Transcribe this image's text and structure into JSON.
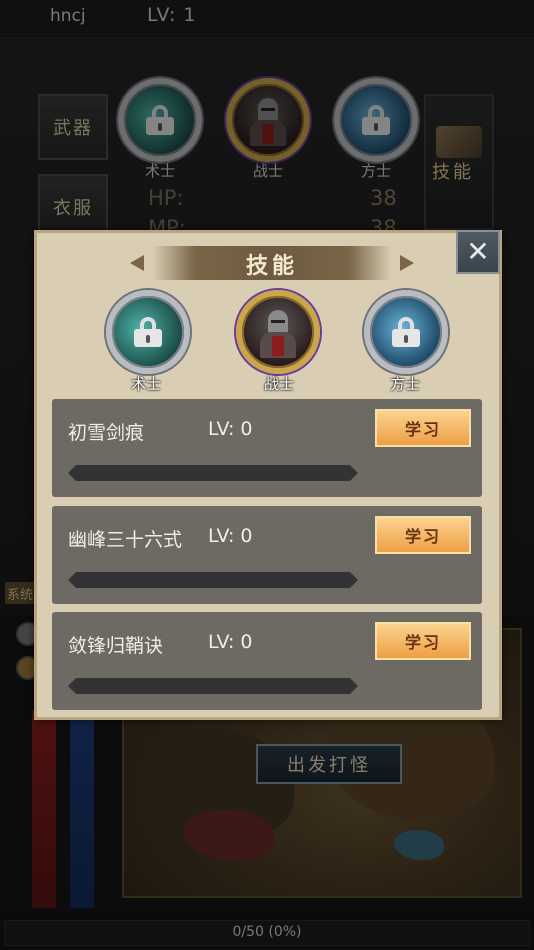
{
  "header": {
    "player_name": "hncj",
    "level": "LV: 1"
  },
  "side_tabs": [
    "武器",
    "衣服"
  ],
  "skill_tab_label": "技能",
  "top_characters": [
    {
      "label": "术士",
      "locked": true
    },
    {
      "label": "战士",
      "locked": false
    },
    {
      "label": "方士",
      "locked": true
    }
  ],
  "stats": [
    {
      "label": "HP:",
      "value": "38"
    },
    {
      "label": "MP:",
      "value": "38"
    }
  ],
  "system_tag": "系统",
  "map": {
    "go_button": "出发打怪"
  },
  "footer": {
    "xp_text": "0/50  (0%)"
  },
  "skill_dialog": {
    "title": "技能",
    "characters": [
      {
        "label": "术士",
        "locked": true
      },
      {
        "label": "战士",
        "locked": false
      },
      {
        "label": "方士",
        "locked": true
      }
    ],
    "skills": [
      {
        "name": "初雪剑痕",
        "level": "LV: 0",
        "button": "学习",
        "progress": 0
      },
      {
        "name": "幽峰三十六式",
        "level": "LV: 0",
        "button": "学习",
        "progress": 0
      },
      {
        "name": "敛锋归鞘诀",
        "level": "LV: 0",
        "button": "学习",
        "progress": 0
      }
    ]
  },
  "colors": {
    "dialog_bg": "#d9ceb4",
    "row_bg": "#6d6a63",
    "learn_button": "#f3b462",
    "title_text": "#f3ead2"
  }
}
